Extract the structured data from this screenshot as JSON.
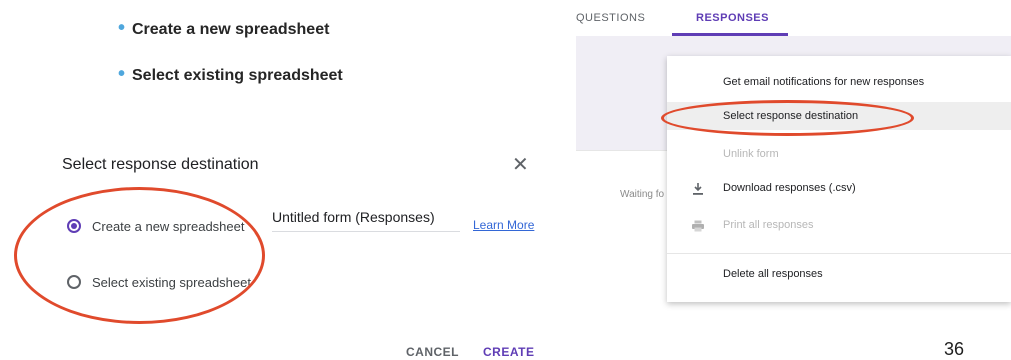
{
  "bullets": [
    "Create a new spreadsheet",
    "Select existing spreadsheet"
  ],
  "dialog": {
    "title": "Select response destination",
    "close_icon": "close-icon",
    "options": [
      {
        "label": "Create a new spreadsheet",
        "selected": true
      },
      {
        "label": "Select existing spreadsheet",
        "selected": false
      }
    ],
    "spreadsheet_name": "Untitled form (Responses)",
    "learn_more": "Learn More",
    "cancel": "CANCEL",
    "create": "CREATE"
  },
  "forms": {
    "tabs": [
      "QUESTIONS",
      "RESPONSES"
    ],
    "active_tab": "RESPONSES",
    "waiting_text": "Waiting fo",
    "menu": [
      {
        "label": "Get email notifications for new responses",
        "icon": "",
        "disabled": false
      },
      {
        "label": "Select response destination",
        "icon": "",
        "disabled": false,
        "highlighted": true
      },
      {
        "label": "Unlink form",
        "icon": "",
        "disabled": true
      },
      {
        "label": "Download responses (.csv)",
        "icon": "download-icon",
        "disabled": false
      },
      {
        "label": "Print all responses",
        "icon": "print-icon",
        "disabled": true
      },
      {
        "label": "Delete all responses",
        "icon": "",
        "disabled": false
      }
    ]
  },
  "page_number": "36",
  "colors": {
    "accent": "#5f3db5",
    "highlight_ring": "#e04a2c",
    "link": "#3367d6",
    "bullet": "#4fa7dd"
  }
}
